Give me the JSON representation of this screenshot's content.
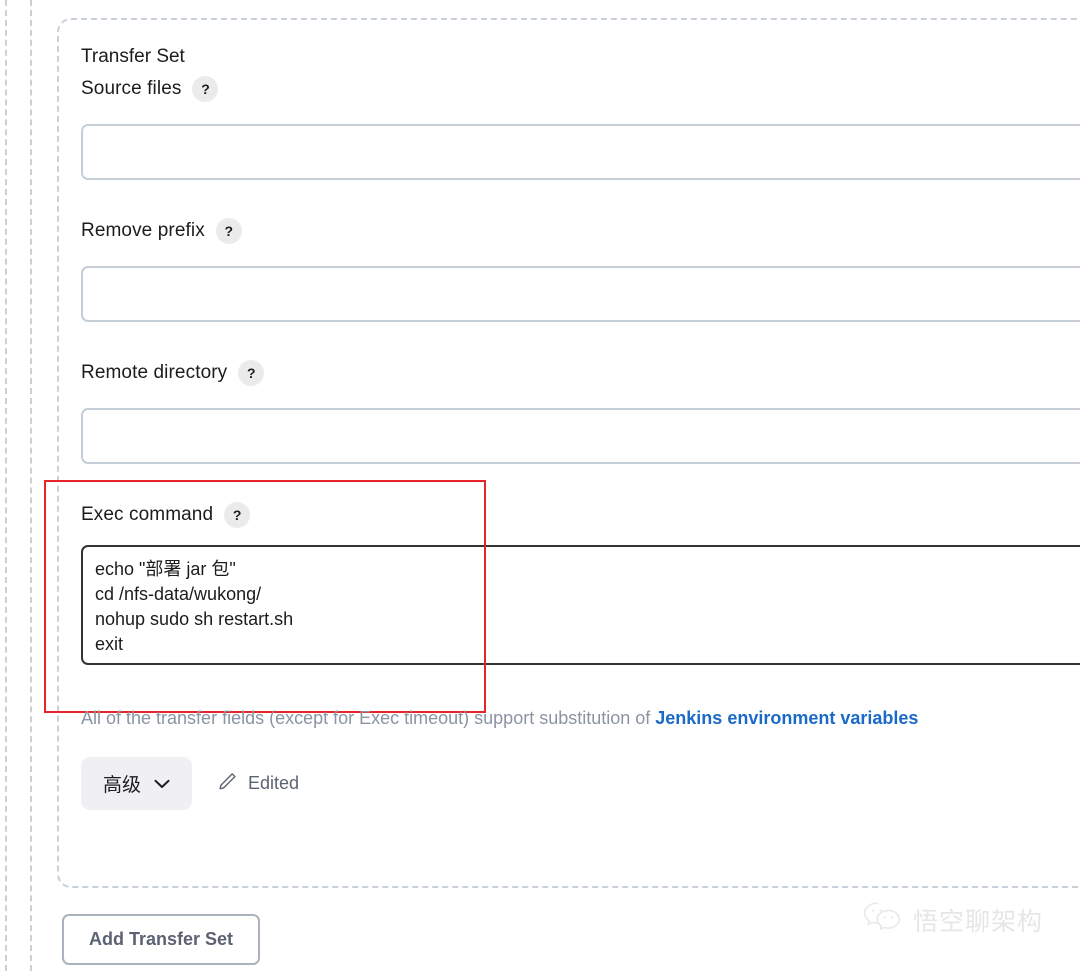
{
  "section": {
    "title": "Transfer Set"
  },
  "fields": [
    {
      "name": "source-files",
      "label": "Source files",
      "help": "?",
      "value": "",
      "placeholder": ""
    },
    {
      "name": "remove-prefix",
      "label": "Remove prefix",
      "help": "?",
      "value": "",
      "placeholder": ""
    },
    {
      "name": "remote-directory",
      "label": "Remote directory",
      "help": "?",
      "value": "",
      "placeholder": ""
    }
  ],
  "exec_command": {
    "label": "Exec command",
    "help": "?",
    "value": "echo \"部署 jar 包\"\ncd /nfs-data/wukong/\nnohup sudo sh restart.sh\nexit",
    "placeholder": ""
  },
  "helper": {
    "prefix": "All of the transfer fields (except for Exec timeout) support substitution of ",
    "link_text": "Jenkins environment variables",
    "link_color": "#1b6ac9",
    "text_color": "#8b94a3"
  },
  "advanced": {
    "label": "高级",
    "chevron_icon": "chevron-down-icon",
    "edited_label": "Edited",
    "edit_icon": "pencil-icon"
  },
  "buttons": {
    "add_transfer_set": "Add Transfer Set"
  },
  "annotation": {
    "color": "#e8232a",
    "shape": "rectangle"
  },
  "watermark": {
    "text": "悟空聊架构",
    "icon": "wechat-icon",
    "color": "#d2d2d2"
  },
  "colors": {
    "input_border": "#c5ced6",
    "textarea_border": "#333333",
    "dashed_border": "#c8d0da",
    "label_text": "#1c1c1e",
    "advanced_bg": "#f0f0f3",
    "add_button_border": "#aab2bd",
    "add_button_text": "#5c6273"
  }
}
